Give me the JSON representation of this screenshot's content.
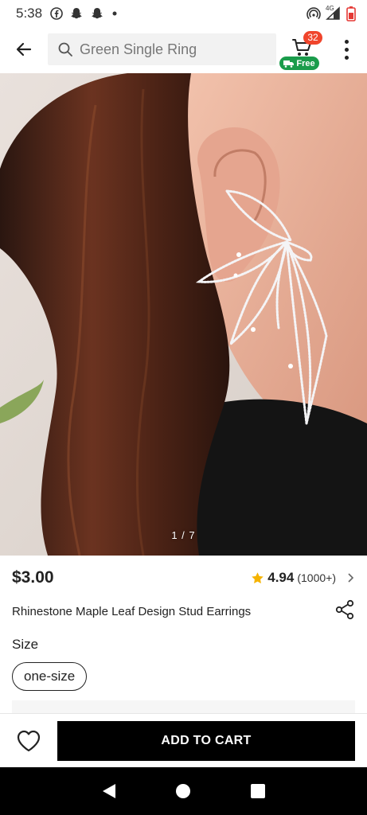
{
  "status_bar": {
    "time": "5:38",
    "network_label": "4G",
    "icons": [
      "facebook-icon",
      "snapchat-icon",
      "snapchat-icon",
      "dot-icon",
      "hotspot-icon",
      "signal-icon",
      "battery-icon"
    ]
  },
  "header": {
    "search_placeholder": "Green Single Ring",
    "cart_count": "32",
    "free_label": "Free"
  },
  "gallery": {
    "counter": "1 / 7"
  },
  "product": {
    "price": "$3.00",
    "rating": "4.94",
    "rating_count": "(1000+)",
    "title": "Rhinestone Maple Leaf Design Stud Earrings",
    "size_label": "Size",
    "size_option": "one-size"
  },
  "actions": {
    "add_to_cart": "ADD TO CART"
  },
  "colors": {
    "badge": "#f0452c",
    "free_tag": "#1a9c4b",
    "star": "#f5b301",
    "cta": "#000000"
  }
}
